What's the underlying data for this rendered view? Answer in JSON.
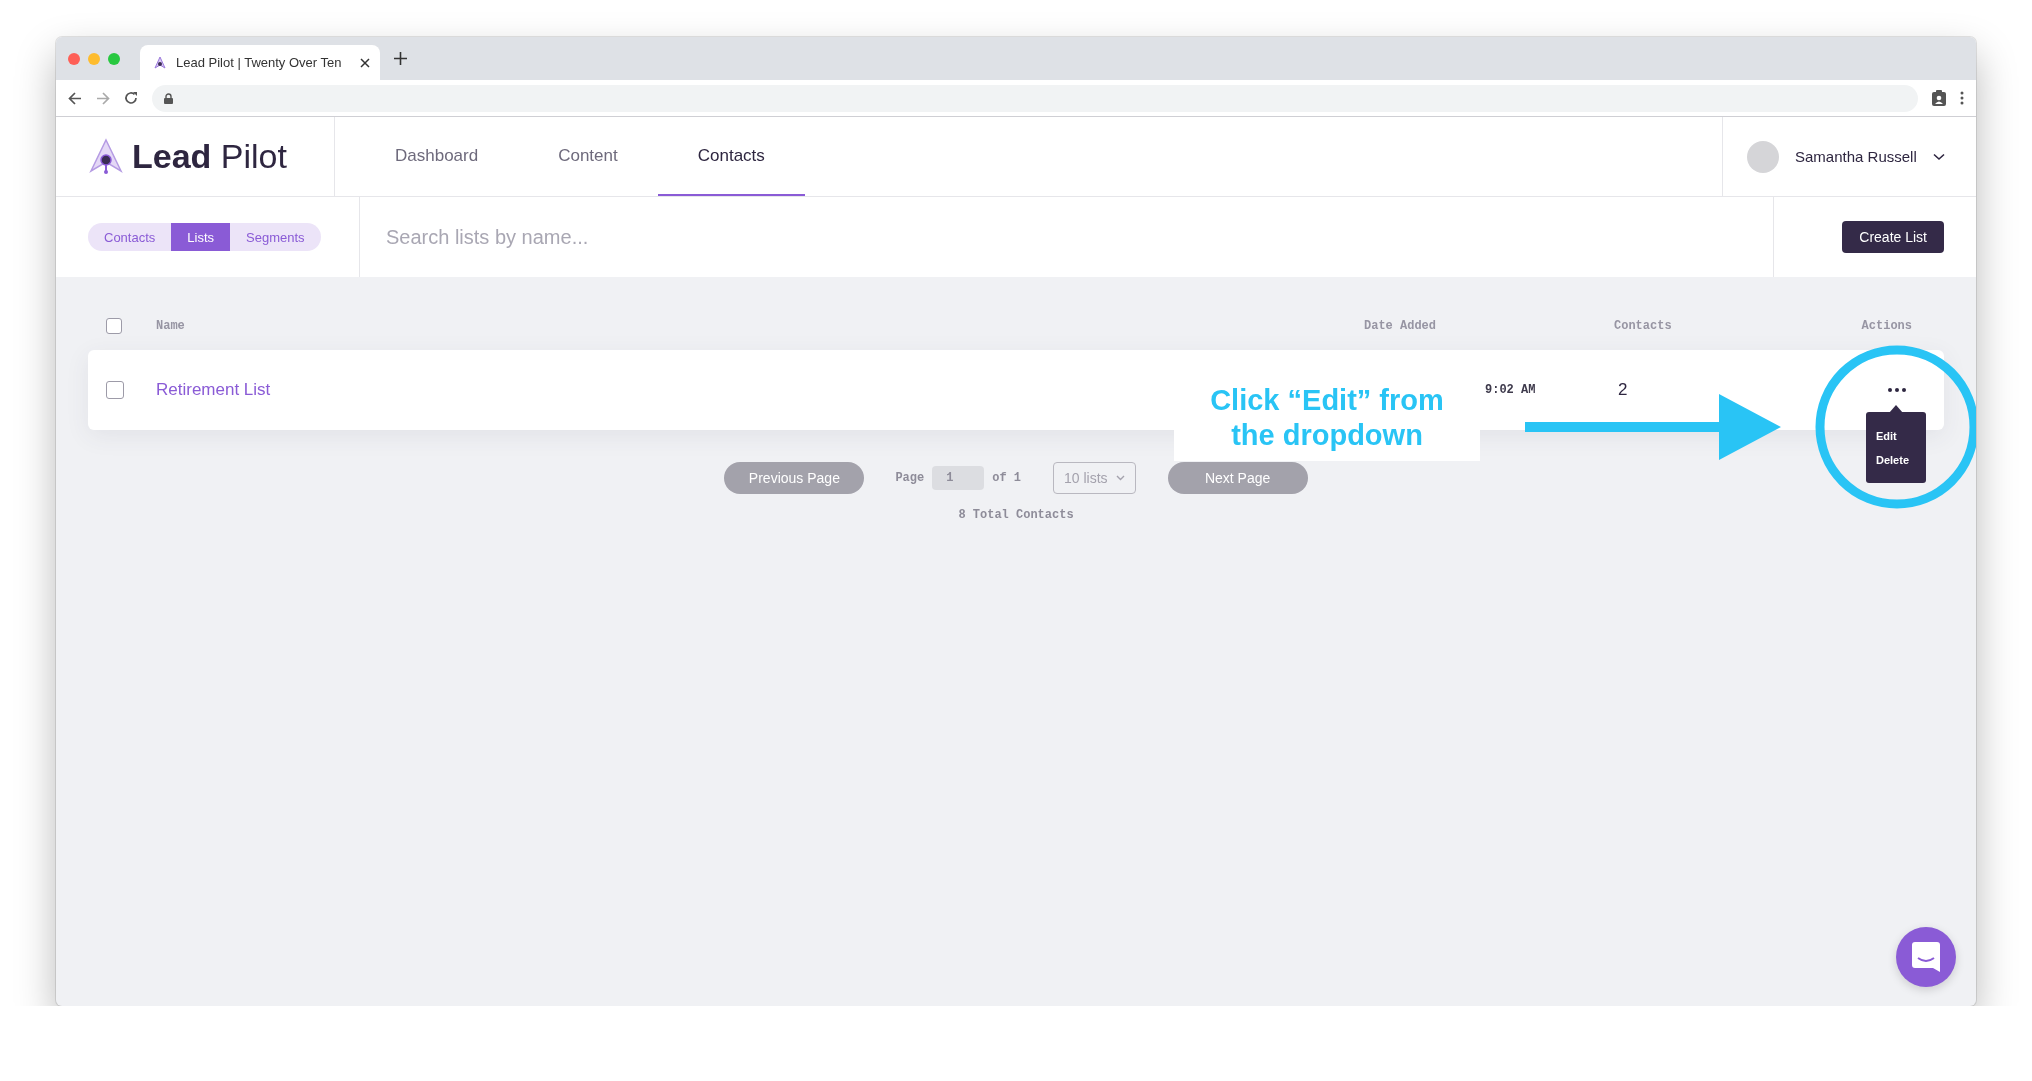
{
  "browser": {
    "tab_title": "Lead Pilot | Twenty Over Ten"
  },
  "header": {
    "logo": {
      "bold": "Lead",
      "light": "Pilot"
    },
    "nav": [
      {
        "label": "Dashboard",
        "selected": false
      },
      {
        "label": "Content",
        "selected": false
      },
      {
        "label": "Contacts",
        "selected": true
      }
    ],
    "user": {
      "name": "Samantha Russell"
    }
  },
  "subnav": {
    "segments": [
      {
        "label": "Contacts",
        "selected": false
      },
      {
        "label": "Lists",
        "selected": true
      },
      {
        "label": "Segments",
        "selected": false
      }
    ],
    "search": {
      "placeholder": "Search lists by name..."
    },
    "create_button": "Create List"
  },
  "table": {
    "select_all": {
      "checked": false
    },
    "columns": [
      "Name",
      "Date Added",
      "Contacts",
      "Actions"
    ],
    "rows": [
      {
        "checked": false,
        "name": "Retirement List",
        "date_added": "9:02 AM",
        "contacts": "2"
      }
    ]
  },
  "dropdown": {
    "items": [
      "Edit",
      "Delete"
    ]
  },
  "pagination": {
    "previous": "Previous Page",
    "page_label": "Page",
    "page": "1",
    "of": "of 1",
    "per_page": "10 lists",
    "next": "Next Page",
    "total": "8 Total Contacts"
  },
  "annotation": {
    "text": "Click “Edit” from the dropdown"
  }
}
